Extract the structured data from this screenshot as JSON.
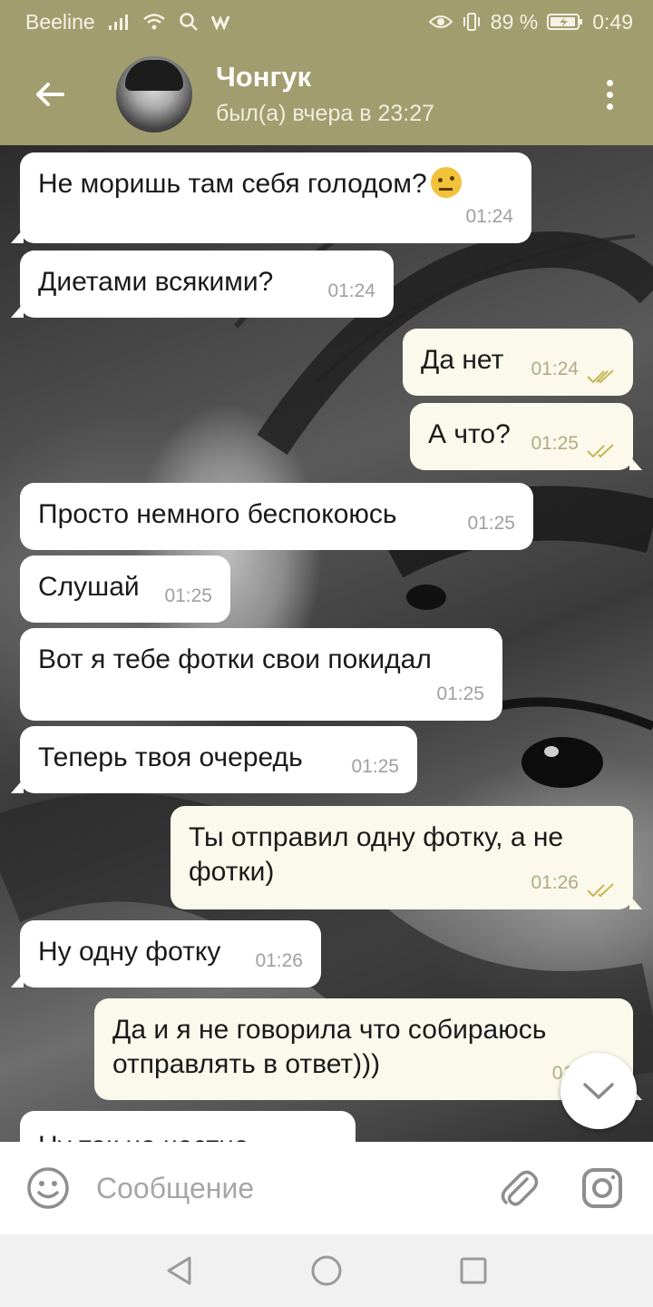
{
  "status_bar": {
    "carrier": "Beeline",
    "battery": "89 %",
    "time": "0:49"
  },
  "header": {
    "back_icon": "arrow-left-icon",
    "name": "Чонгук",
    "last_seen": "был(а) вчера в 23:27",
    "menu_icon": "more-vertical-icon"
  },
  "messages": [
    {
      "direction": "in",
      "text": "Не моришь там себя голодом?",
      "emoji": "face-with-raised-eyebrow",
      "time": "01:24"
    },
    {
      "direction": "in",
      "text": "Диетами всякими?",
      "time": "01:24"
    },
    {
      "direction": "out",
      "text": "Да нет",
      "time": "01:24",
      "status": "read"
    },
    {
      "direction": "out",
      "text": "А что?",
      "time": "01:25",
      "status": "read"
    },
    {
      "direction": "in",
      "text": "Просто немного беспокоюсь",
      "time": "01:25"
    },
    {
      "direction": "in",
      "text": "Слушай",
      "time": "01:25"
    },
    {
      "direction": "in",
      "text": "Вот я тебе фотки свои покидал",
      "time": "01:25"
    },
    {
      "direction": "in",
      "text": "Теперь твоя очередь",
      "time": "01:25"
    },
    {
      "direction": "out",
      "text": "Ты отправил одну фотку, а не фотки)",
      "time": "01:26",
      "status": "read"
    },
    {
      "direction": "in",
      "text": "Ну одну фотку",
      "time": "01:26"
    },
    {
      "direction": "out",
      "text": "Да и я не говорила что собираюсь отправлять в ответ)))",
      "time": "01:"
    },
    {
      "direction": "in",
      "text": "Ну так не честно",
      "partial": true
    }
  ],
  "input": {
    "placeholder": "Сообщение",
    "emoji_icon": "smiley-icon",
    "attach_icon": "paperclip-icon",
    "camera_icon": "camera-icon"
  },
  "colors": {
    "header_bg": "#a29d6e",
    "incoming_bubble": "#ffffff",
    "outgoing_bubble": "#fbf9ec",
    "read_check": "#c9b95a"
  }
}
